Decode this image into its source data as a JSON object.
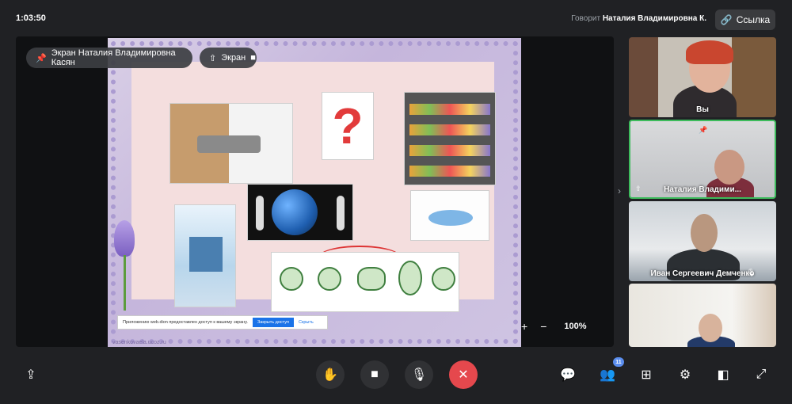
{
  "header": {
    "timer": "1:03:50",
    "speaking_prefix": "Говорит",
    "speaking_name": "Наталия Владимировна К.",
    "link_label": "Ссылка"
  },
  "stage": {
    "owner_pill": "Экран Наталия Владимировна Касян",
    "screen_pill": "Экран",
    "zoom_level": "100%",
    "zoom_in": "+",
    "zoom_out": "−",
    "share_notice": {
      "text": "Приложению web.dion предоставлен доступ к вашему экрану.",
      "stop_label": "Закрыть доступ",
      "hide_label": "Скрыть"
    },
    "watermark": "vasenkovaela.ucoz.ru"
  },
  "participants": [
    {
      "name": "Вы"
    },
    {
      "name": "Наталия Владими..."
    },
    {
      "name": "Иван Сергеевич Демченко"
    },
    {
      "name": ""
    }
  ],
  "toolbar": {
    "participants_count": "11"
  },
  "colors": {
    "hangup": "#e5484d",
    "active_speaker_border": "#3dbb5c",
    "badge": "#5a8dee"
  }
}
